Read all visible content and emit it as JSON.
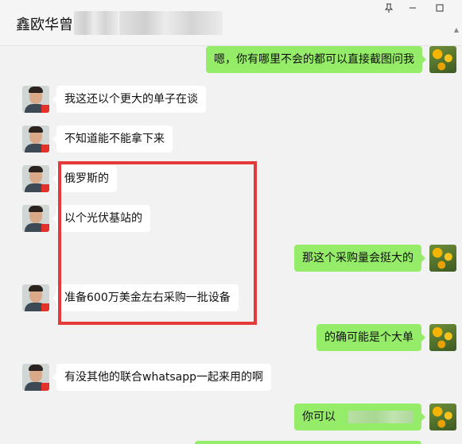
{
  "header": {
    "title": "鑫欧华曾"
  },
  "window": {
    "pin_icon": "pin-icon",
    "minimize_icon": "minimize-icon",
    "maximize_icon": "maximize-icon"
  },
  "messages": [
    {
      "side": "out",
      "text": "嗯，你有哪里不会的都可以直接截图问我"
    },
    {
      "side": "in",
      "text": "我这还以个更大的单子在谈"
    },
    {
      "side": "in",
      "text": "不知道能不能拿下来"
    },
    {
      "side": "in",
      "text": "俄罗斯的"
    },
    {
      "side": "in",
      "text": "以个光伏基站的"
    },
    {
      "side": "out",
      "text": "那这个采购量会挺大的"
    },
    {
      "side": "in",
      "text": "准备600万美金左右采购一批设备"
    },
    {
      "side": "out",
      "text": "的确可能是个大单"
    },
    {
      "side": "in",
      "text": "有没其他的联合whatsapp一起来用的啊"
    },
    {
      "side": "out",
      "text": "你可以"
    }
  ],
  "colors": {
    "accent_green": "#95ec69",
    "highlight_red": "#e53a3a",
    "background": "#f2f2f2"
  }
}
